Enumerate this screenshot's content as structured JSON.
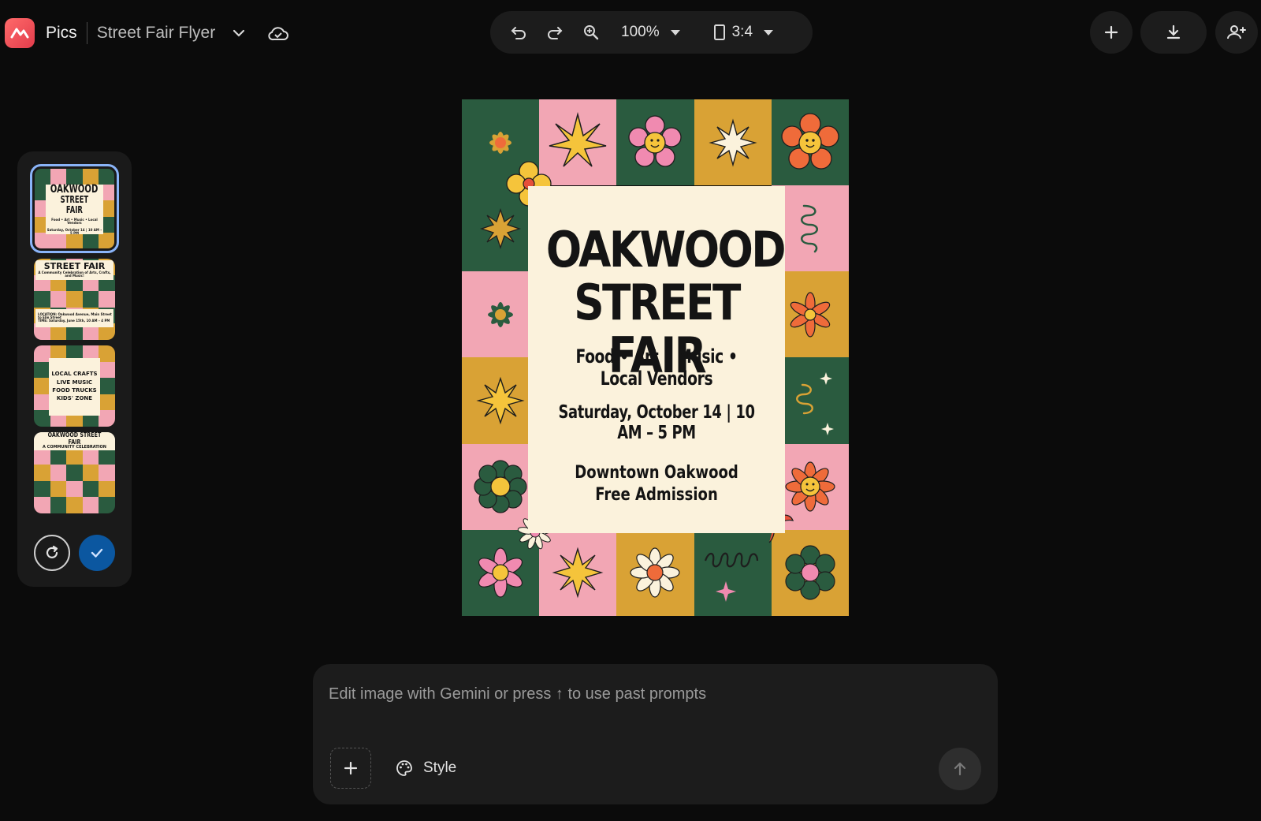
{
  "header": {
    "app_name": "Pics",
    "doc_title": "Street Fair Flyer",
    "zoom": "100%",
    "aspect_ratio": "3:4"
  },
  "icons": {
    "logo": "pics-logo-icon",
    "doc_menu": "chevron-down-icon",
    "cloud": "cloud-saved-icon",
    "undo": "undo-icon",
    "redo": "redo-icon",
    "zoom": "zoom-in-icon",
    "ratio": "aspect-ratio-icon",
    "new": "plus-icon",
    "download": "download-icon",
    "share": "add-person-icon"
  },
  "variants": [
    {
      "selected": true,
      "lines": [
        "OAKWOOD",
        "STREET FAIR",
        "Food • Art • Music • Local Vendors",
        "Saturday, October 14 | 10 AM – 5 PM"
      ]
    },
    {
      "selected": false,
      "lines": [
        "STREET FAIR",
        "A Community Celebration of Arts, Crafts, and Music!",
        "LOCATION: Oakwood Avenue, Main Street to Elm Street",
        "TIME: Saturday, June 15th, 10 AM – 4 PM"
      ]
    },
    {
      "selected": false,
      "lines": [
        "LOCAL CRAFTS",
        "LIVE MUSIC",
        "FOOD TRUCKS",
        "KIDS' ZONE"
      ]
    },
    {
      "selected": false,
      "lines": [
        "OAKWOOD STREET FAIR",
        "A COMMUNITY CELEBRATION"
      ]
    }
  ],
  "poster": {
    "title_line1": "OAKWOOD",
    "title_line2": "STREET FAIR",
    "subtitle": "Food • Art • Music • Local Vendors",
    "datetime": "Saturday, October 14 | 10 AM – 5 PM",
    "location": "Downtown Oakwood",
    "admission": "Free Admission"
  },
  "prompt": {
    "placeholder": "Edit image with Gemini or press ↑ to use past prompts",
    "style_label": "Style"
  },
  "colors": {
    "green": "#2a5b3f",
    "pink": "#f2a6b4",
    "mustard": "#d9a235",
    "cream": "#fbf2dc",
    "accent_blue": "#8ab4f8",
    "confirm_blue": "#0b57a0"
  }
}
